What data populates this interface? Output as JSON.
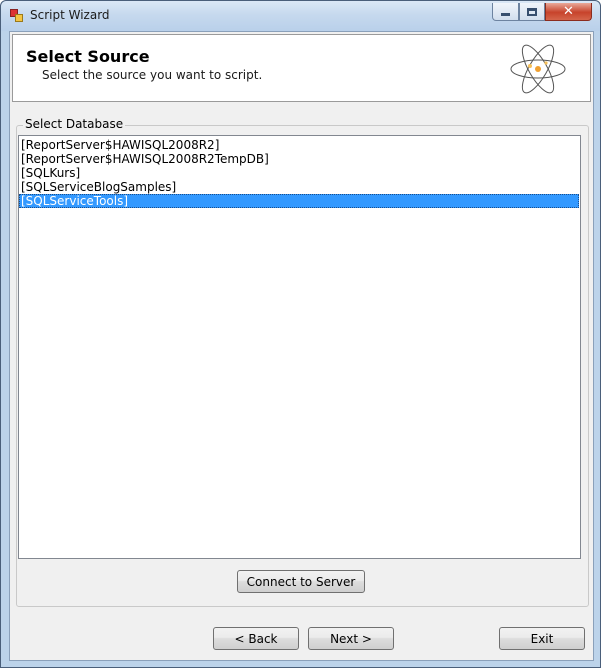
{
  "window": {
    "title": "Script Wizard",
    "close_glyph": "✕"
  },
  "header": {
    "title": "Select Source",
    "subtitle": "Select the source you want to script.",
    "icon": "atom-icon"
  },
  "database_group": {
    "label": "Select Database",
    "items": [
      "[ReportServer$HAWISQL2008R2]",
      "[ReportServer$HAWISQL2008R2TempDB]",
      "[SQLKurs]",
      "[SQLServiceBlogSamples]",
      "[SQLServiceTools]"
    ],
    "selected_item": "[SQLServiceTools]",
    "selection_color": "#3399ff"
  },
  "buttons": {
    "connect": "Connect to Server",
    "back": "< Back",
    "next": "Next >",
    "exit": "Exit"
  }
}
